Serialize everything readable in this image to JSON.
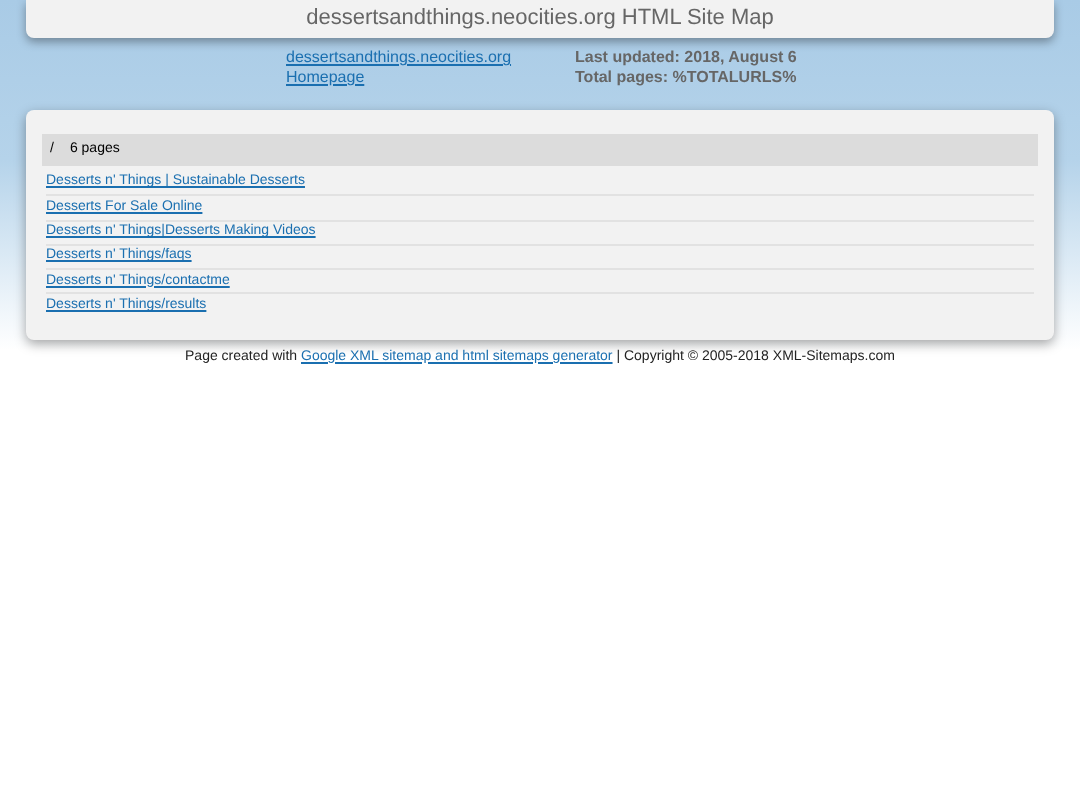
{
  "header": {
    "title": "dessertsandthings.neocities.org HTML Site Map"
  },
  "info": {
    "links": [
      "dessertsandthings.neocities.org",
      "Homepage"
    ],
    "last_updated": "Last updated: 2018, August 6",
    "total_pages": "Total pages: %TOTALURLS%"
  },
  "section": {
    "path": "/",
    "count": "6 pages",
    "pages": [
      "Desserts n' Things | Sustainable Desserts",
      "Desserts For Sale Online",
      "Desserts n' Things|Desserts Making Videos",
      "Desserts n' Things/faqs",
      "Desserts n' Things/contactme",
      "Desserts n' Things/results"
    ]
  },
  "footer": {
    "prefix": "Page created with",
    "link": "Google XML sitemap and html sitemaps generator",
    "suffix": "| Copyright © 2005-2018 XML-Sitemaps.com"
  }
}
